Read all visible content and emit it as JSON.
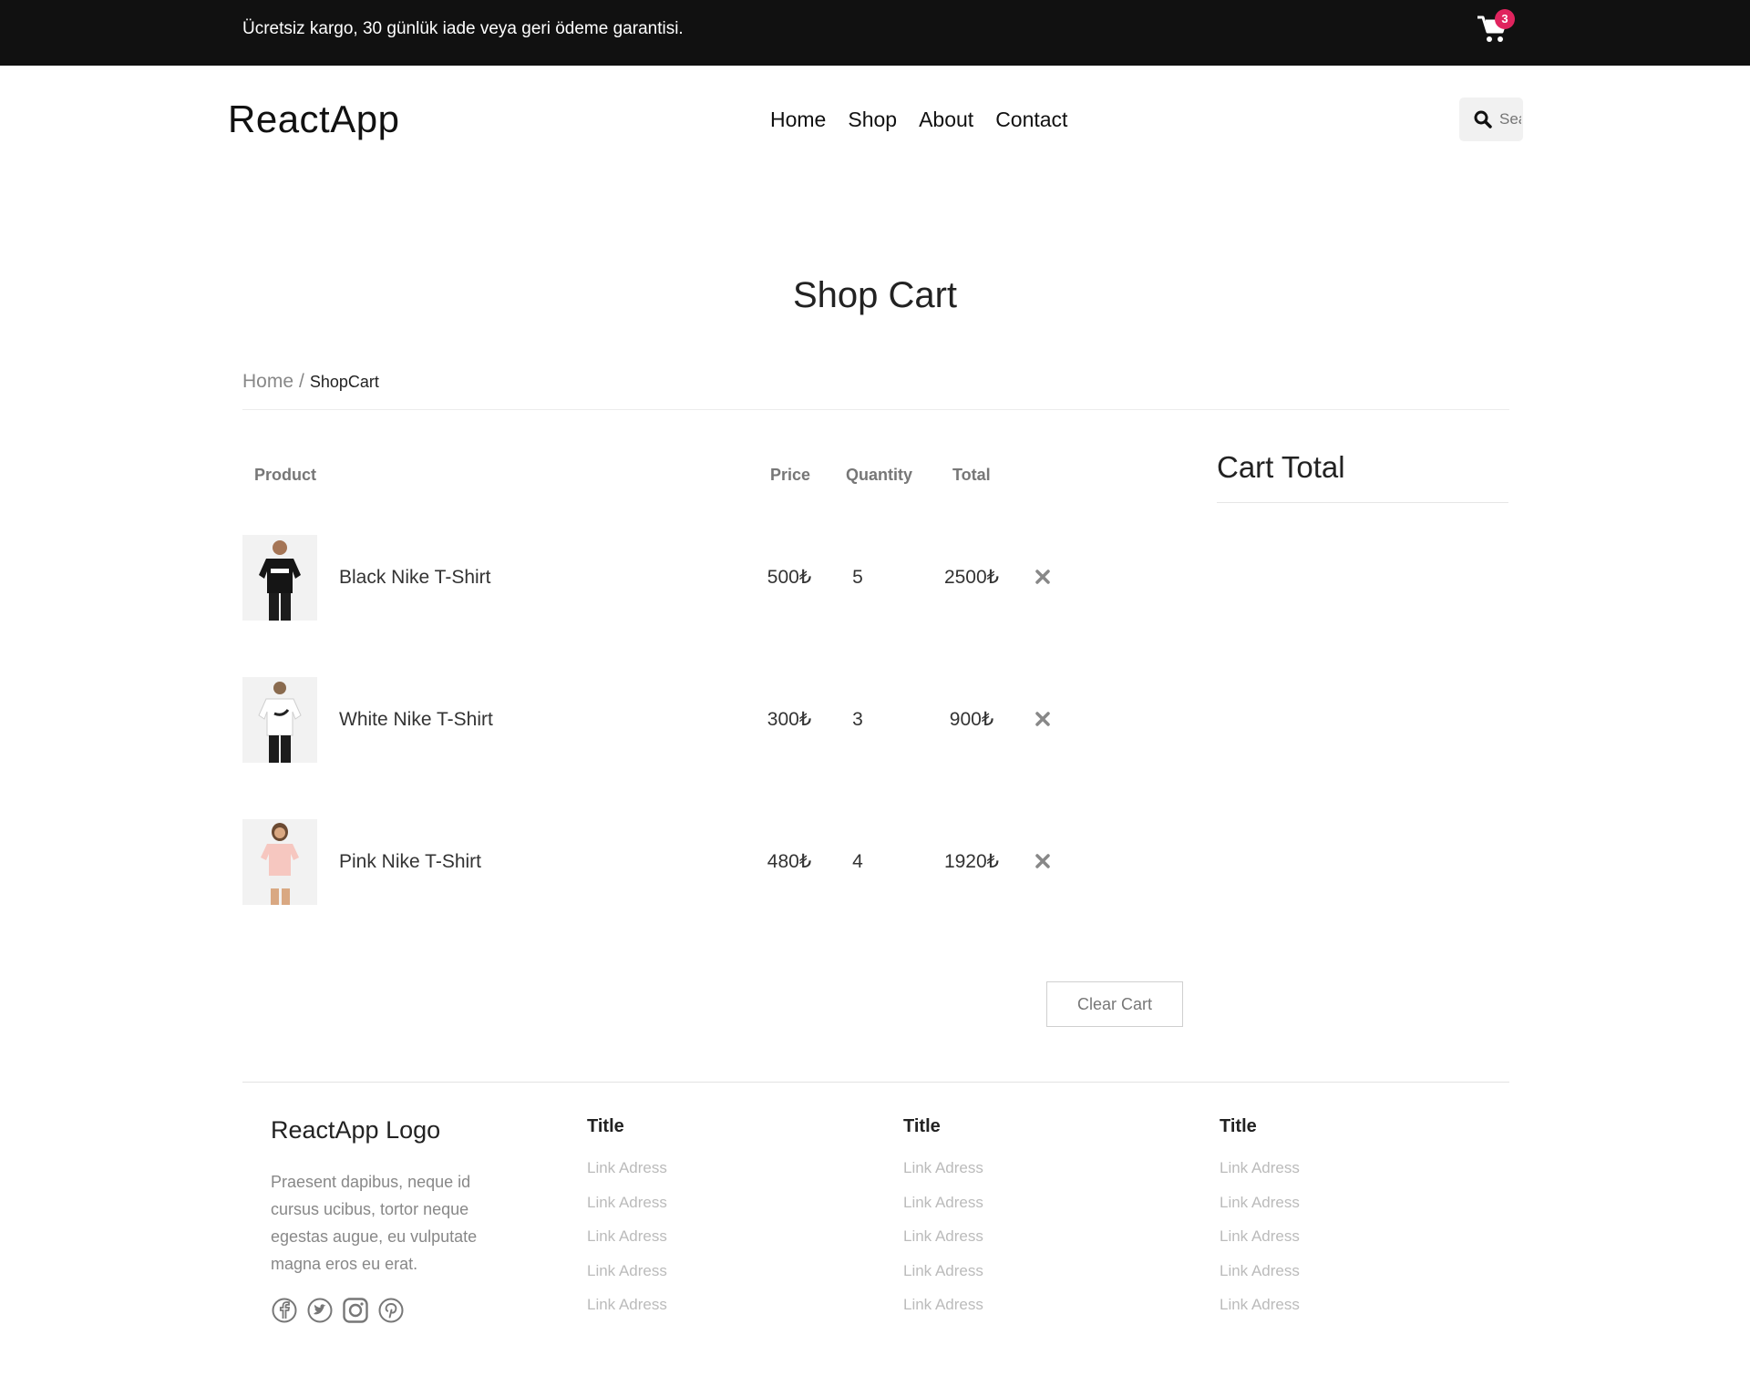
{
  "topbar": {
    "message": "Ücretsiz kargo, 30 günlük iade veya geri ödeme garantisi.",
    "cart_count": "3"
  },
  "header": {
    "logo_light": "React",
    "logo_bold": "App",
    "nav": [
      {
        "label": "Home"
      },
      {
        "label": "Shop"
      },
      {
        "label": "About"
      },
      {
        "label": "Contact"
      }
    ],
    "search_placeholder": "Search"
  },
  "page": {
    "title": "Shop Cart",
    "breadcrumb": {
      "home": "Home",
      "sep": "/",
      "current": "ShopCart"
    }
  },
  "cart": {
    "headers": {
      "product": "Product",
      "price": "Price",
      "quantity": "Quantity",
      "total": "Total"
    },
    "items": [
      {
        "name": "Black Nike T-Shirt",
        "price": "500₺",
        "quantity": "5",
        "total": "2500₺"
      },
      {
        "name": "White Nike T-Shirt",
        "price": "300₺",
        "quantity": "3",
        "total": "900₺"
      },
      {
        "name": "Pink Nike T-Shirt",
        "price": "480₺",
        "quantity": "4",
        "total": "1920₺"
      }
    ],
    "clear_label": "Clear Cart",
    "total_title": "Cart Total"
  },
  "footer": {
    "logo": "ReactApp Logo",
    "description": "Praesent dapibus, neque id cursus ucibus, tortor neque egestas augue, eu vulputate magna eros eu erat.",
    "columns": [
      {
        "title": "Title",
        "links": [
          "Link Adress",
          "Link Adress",
          "Link Adress",
          "Link Adress",
          "Link Adress"
        ]
      },
      {
        "title": "Title",
        "links": [
          "Link Adress",
          "Link Adress",
          "Link Adress",
          "Link Adress",
          "Link Adress"
        ]
      },
      {
        "title": "Title",
        "links": [
          "Link Adress",
          "Link Adress",
          "Link Adress",
          "Link Adress",
          "Link Adress"
        ]
      }
    ],
    "socials": [
      "facebook-icon",
      "twitter-icon",
      "instagram-icon",
      "pinterest-icon"
    ]
  },
  "colors": {
    "topbar_bg": "#111111",
    "badge": "#e0245e",
    "text": "#222222",
    "muted": "#888888",
    "link": "#bbbbbb"
  }
}
